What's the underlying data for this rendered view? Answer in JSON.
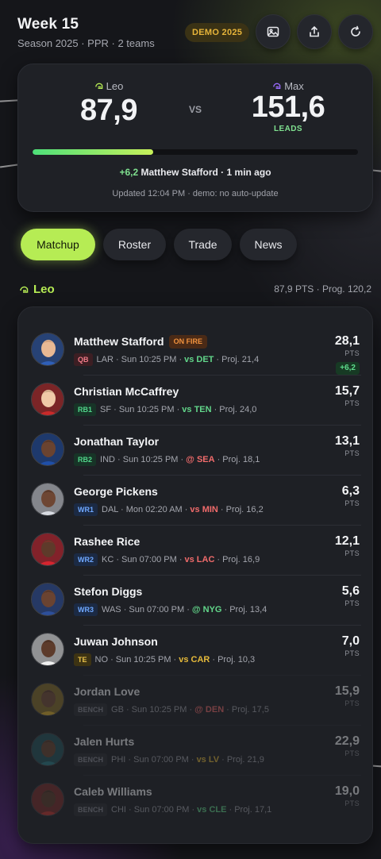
{
  "header": {
    "title": "Week 15",
    "subtitle": "Season 2025 · PPR · 2 teams",
    "badge": "DEMO 2025",
    "actions": [
      {
        "icon": "image-icon"
      },
      {
        "icon": "share-icon"
      },
      {
        "icon": "refresh-icon"
      }
    ]
  },
  "scoreboard": {
    "home": {
      "name": "Leo",
      "score": "87,9",
      "icon": "helmet-icon",
      "color": "#b6ec54"
    },
    "vs": "VS",
    "away": {
      "name": "Max",
      "score": "151,6",
      "icon": "helmet-icon",
      "color": "#9b6bff",
      "status": "LEADS"
    },
    "progress_fraction": 0.37,
    "last_play_delta": "+6,2",
    "last_play_text": "Matthew Stafford · 1 min ago",
    "updated": "Updated 12:04 PM · demo: no auto-update"
  },
  "tabs": [
    {
      "label": "Matchup",
      "active": true
    },
    {
      "label": "Roster",
      "active": false
    },
    {
      "label": "Trade",
      "active": false
    },
    {
      "label": "News",
      "active": false
    }
  ],
  "team_section": {
    "name": "Leo",
    "summary": "87,9 PTS · Prog. 120,2"
  },
  "players": [
    {
      "name": "Matthew Stafford",
      "tag": "ON FIRE",
      "pos": "QB",
      "pos_class": "qb",
      "team": "LAR · Sun 10:25 PM ·",
      "opp": "vs DET",
      "opp_class": "good",
      "proj": "· Proj. 21,4",
      "pts": "28,1",
      "pts_label": "PTS",
      "delta": "+6,2",
      "bench": false,
      "skin": "#e8b894",
      "hair": "#8a5a3a",
      "jersey": "#2f5fb8"
    },
    {
      "name": "Christian McCaffrey",
      "tag": "",
      "pos": "RB1",
      "pos_class": "rb",
      "team": "SF · Sun 10:25 PM ·",
      "opp": "vs TEN",
      "opp_class": "good",
      "proj": "· Proj. 24,0",
      "pts": "15,7",
      "pts_label": "PTS",
      "delta": "",
      "bench": false,
      "skin": "#f0c9a8",
      "hair": "#6b4a2a",
      "jersey": "#c92a2a"
    },
    {
      "name": "Jonathan Taylor",
      "tag": "",
      "pos": "RB2",
      "pos_class": "rb",
      "team": "IND · Sun 10:25 PM ·",
      "opp": "@ SEA",
      "opp_class": "bad",
      "proj": "· Proj. 18,1",
      "pts": "13,1",
      "pts_label": "PTS",
      "delta": "",
      "bench": false,
      "skin": "#6a4330",
      "hair": "#1e1410",
      "jersey": "#1f4fa8"
    },
    {
      "name": "George Pickens",
      "tag": "",
      "pos": "WR1",
      "pos_class": "wr",
      "team": "DAL · Mon 02:20 AM ·",
      "opp": "vs MIN",
      "opp_class": "bad",
      "proj": "· Proj. 16,2",
      "pts": "6,3",
      "pts_label": "PTS",
      "delta": "",
      "bench": false,
      "skin": "#6e4633",
      "hair": "#1a1210",
      "jersey": "#d8dbe2"
    },
    {
      "name": "Rashee Rice",
      "tag": "",
      "pos": "WR2",
      "pos_class": "wr",
      "team": "KC · Sun 07:00 PM ·",
      "opp": "vs LAC",
      "opp_class": "bad",
      "proj": "· Proj. 16,9",
      "pts": "12,1",
      "pts_label": "PTS",
      "delta": "",
      "bench": false,
      "skin": "#5e3a2a",
      "hair": "#c71f2b",
      "jersey": "#d6252f"
    },
    {
      "name": "Stefon Diggs",
      "tag": "",
      "pos": "WR3",
      "pos_class": "wr",
      "team": "WAS · Sun 07:00 PM ·",
      "opp": "@ NYG",
      "opp_class": "good",
      "proj": "· Proj. 13,4",
      "pts": "5,6",
      "pts_label": "PTS",
      "delta": "",
      "bench": false,
      "skin": "#6a4331",
      "hair": "#1c1411",
      "jersey": "#2d4f9a"
    },
    {
      "name": "Juwan Johnson",
      "tag": "",
      "pos": "TE",
      "pos_class": "te",
      "team": "NO · Sun 10:25 PM ·",
      "opp": "vs CAR",
      "opp_class": "mid",
      "proj": "· Proj. 10,3",
      "pts": "7,0",
      "pts_label": "PTS",
      "delta": "",
      "bench": false,
      "skin": "#5d3b2b",
      "hair": "#1b1411",
      "jersey": "#f0f0f0"
    },
    {
      "name": "Jordan Love",
      "tag": "",
      "pos": "BENCH",
      "pos_class": "bench",
      "team": "GB · Sun 10:25 PM ·",
      "opp": "@ DEN",
      "opp_class": "bad",
      "proj": "· Proj. 17,5",
      "pts": "15,9",
      "pts_label": "PTS",
      "delta": "",
      "bench": true,
      "skin": "#7a5038",
      "hair": "#1e1612",
      "jersey": "#e1b52e"
    },
    {
      "name": "Jalen Hurts",
      "tag": "",
      "pos": "BENCH",
      "pos_class": "bench",
      "team": "PHI · Sun 07:00 PM ·",
      "opp": "vs LV",
      "opp_class": "mid",
      "proj": "· Proj. 21,9",
      "pts": "22,9",
      "pts_label": "PTS",
      "delta": "",
      "bench": true,
      "skin": "#6b4633",
      "hair": "#1c1511",
      "jersey": "#2a7f8a"
    },
    {
      "name": "Caleb Williams",
      "tag": "",
      "pos": "BENCH",
      "pos_class": "bench",
      "team": "CHI · Sun 07:00 PM ·",
      "opp": "vs CLE",
      "opp_class": "good",
      "proj": "· Proj. 17,1",
      "pts": "19,0",
      "pts_label": "PTS",
      "delta": "",
      "bench": true,
      "skin": "#5f3d2c",
      "hair": "#1a1310",
      "jersey": "#c8362f"
    }
  ]
}
